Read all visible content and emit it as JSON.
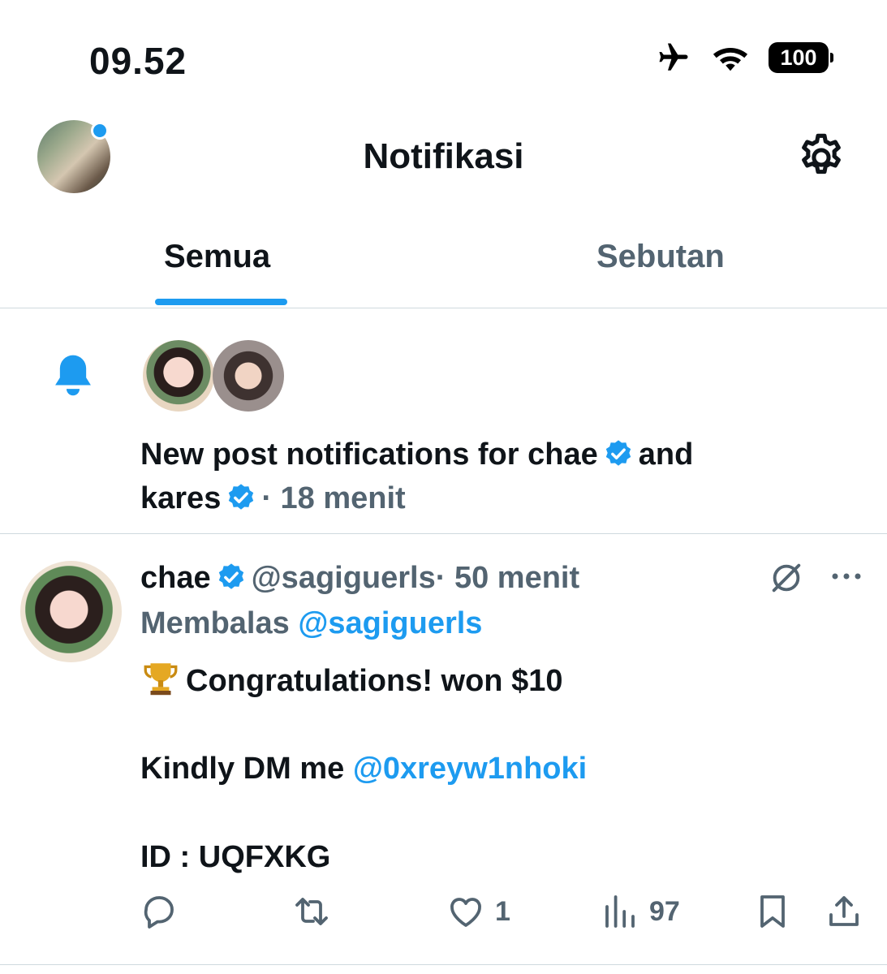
{
  "status": {
    "time": "09.52",
    "battery": "100",
    "icons": [
      "airplane-icon",
      "wifi-icon",
      "battery-icon"
    ]
  },
  "header": {
    "title": "Notifikasi"
  },
  "tabs": [
    {
      "label": "Semua",
      "active": true
    },
    {
      "label": "Sebutan",
      "active": false
    }
  ],
  "notification": {
    "prefix": "New post notifications for ",
    "user1": "chae",
    "conj": "and",
    "user2": "kares",
    "time": "· 18 menit"
  },
  "tweet": {
    "name": "chae",
    "handle": "@sagiguerls",
    "time": "· 50 menit",
    "reply_prefix": "Membalas ",
    "reply_handle": "@sagiguerls",
    "line1": "Congratulations! won $10",
    "line2_prefix": "Kindly DM me ",
    "line2_handle": "@0xreyw1nhoki",
    "line3": "ID : UQFXKG",
    "likes": "1",
    "views": "97"
  },
  "colors": {
    "accent": "#1d9bf0",
    "text": "#0f1419",
    "muted": "#536471",
    "divider": "#cfd9de"
  }
}
